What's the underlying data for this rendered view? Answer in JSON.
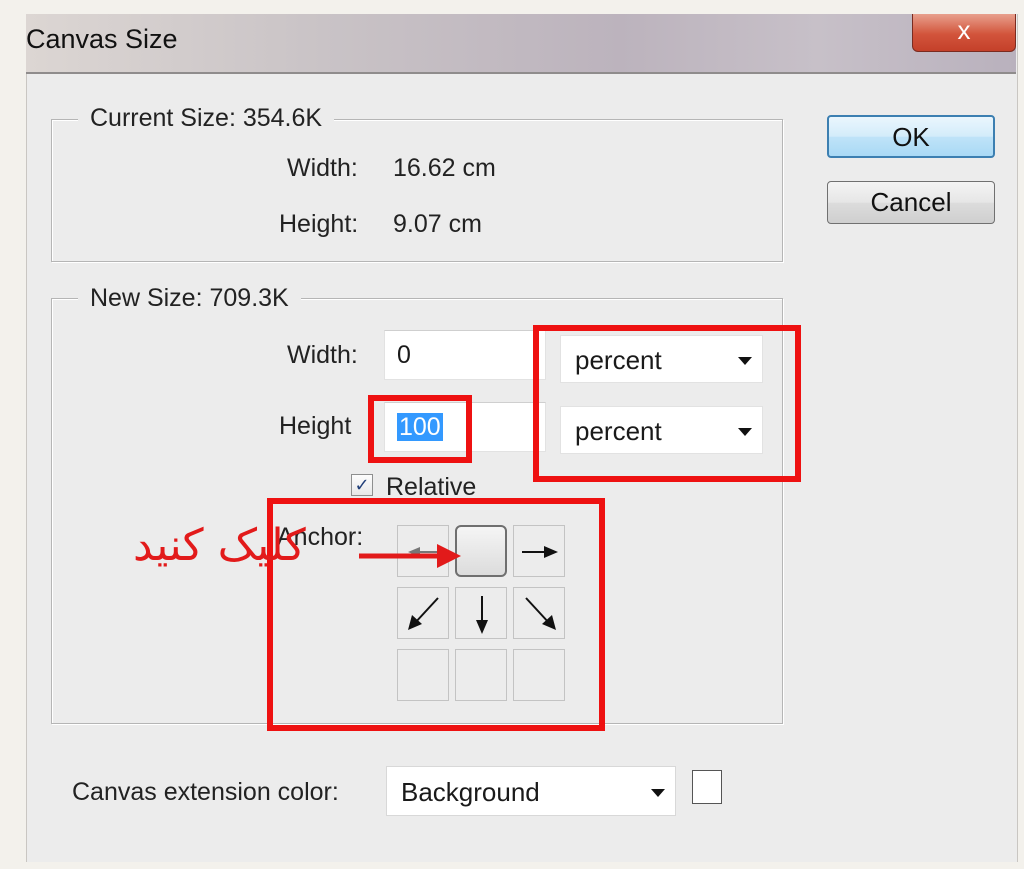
{
  "window": {
    "title": "Canvas Size",
    "close_glyph": "x"
  },
  "current_size": {
    "legend": "Current Size: 354.6K",
    "width_label": "Width:",
    "width_value": "16.62 cm",
    "height_label": "Height:",
    "height_value": "9.07 cm"
  },
  "new_size": {
    "legend": "New Size: 709.3K",
    "width_label": "Width:",
    "width_value": "0",
    "width_unit": "percent",
    "height_label": "Height",
    "height_value": "100",
    "height_unit": "percent",
    "relative_label": "Relative",
    "relative_checked": true,
    "anchor_label": "Anchor:",
    "anchor_selected": "top-center"
  },
  "buttons": {
    "ok": "OK",
    "cancel": "Cancel"
  },
  "extension": {
    "label": "Canvas extension color:",
    "value": "Background",
    "swatch_color": "#ffffff"
  },
  "annotation": {
    "text": "کلیک کنید",
    "color": "#ee1111"
  },
  "icons": {
    "close": "close-icon",
    "dropdown": "chevron-down-icon",
    "check": "checkmark-icon",
    "anchor_arrows": [
      "arrow-left-icon",
      "arrow-right-icon",
      "arrow-down-left-icon",
      "arrow-down-icon",
      "arrow-down-right-icon"
    ]
  }
}
